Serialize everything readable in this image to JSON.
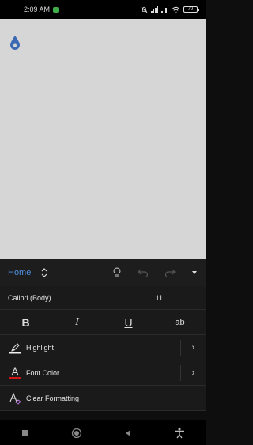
{
  "status_bar": {
    "time": "2:09 AM",
    "battery": "79"
  },
  "ribbon": {
    "tab_label": "Home",
    "icons": [
      "lightbulb-icon",
      "undo-icon",
      "redo-icon",
      "dropdown-icon"
    ]
  },
  "font": {
    "name": "Calibri (Body)",
    "size": "11"
  },
  "format_buttons": {
    "bold": "B",
    "italic": "I",
    "underline": "U",
    "strikethrough": "ab"
  },
  "menu": {
    "highlight": "Highlight",
    "font_color": "Font Color",
    "clear_formatting": "Clear Formatting"
  },
  "colors": {
    "accent": "#4d8fe0",
    "font_color_bar": "#d01818",
    "drop_icon": "#3d6bb3",
    "canvas": "#d6d6d6"
  }
}
